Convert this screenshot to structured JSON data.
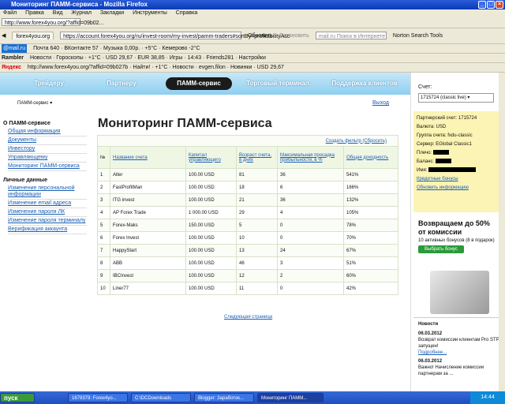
{
  "window": {
    "title": "Мониторинг ПАММ-сервиса - Mozilla Firefox"
  },
  "menu": [
    "Файл",
    "Правка",
    "Вид",
    "Журнал",
    "Закладки",
    "Инструменты",
    "Справка"
  ],
  "browser": {
    "bookmark_url": "http://www.forex4you.org/?affid=09b02...",
    "tab1": "forex4you.org",
    "tab2": "Мониторинг ПАММ-сервиса",
    "url": "https://account.forex4you.org/ru/invest-room/my-invest/pamm-traders#sortBy=profitabilityAsc",
    "reload": "Обновить",
    "stop": "Остановить",
    "search_ph": "mail.ru Поиск в Интернете",
    "norton": "Norton Search Tools",
    "toolbar2": "Почта 640 · ВКонтакте 57 · Музыка 0,00р. · +5°C · Кемерово -2°C",
    "toolbar3": "Новости · Гороскопы · +1°C · USD 29,67 · EUR 38,85 · Игры · 14:43 · Friends281 · Настройки",
    "toolbar4": "http://www.forex4you.org/?affid=09b027b · Найти! · +1°C · Новости · evgen.filon · Новинки · USD 29,67"
  },
  "site": {
    "nav": [
      "Трейдеру",
      "Партнеру",
      "ПАММ-сервис",
      "Торговый терминал",
      "Поддержка клиентов"
    ],
    "selector": "ПАММ-сервис ▾",
    "exit": "Выход",
    "left_h1": "О ПАММ-сервисе",
    "left_links1": [
      "Общая информация",
      "Документы",
      "Инвестору",
      "Управляющему",
      "Мониторинг ПАММ-сервиса"
    ],
    "left_h2": "Личные данные",
    "left_links2": [
      "Изменение персональной информации",
      "Изменение email адреса",
      "Изменение пароля ЛК",
      "Изменение пароля терминалу",
      "Верификация аккаунта"
    ],
    "page_title": "Мониторинг ПАММ-сервиса",
    "filter_link": "Создать фильтр (Сбросить)",
    "columns": [
      "№",
      "Название счета",
      "Капитал управляющего",
      "Возраст счета, в днях",
      "Максимальная просадка прибыльности, в %",
      "Общая доходность"
    ],
    "rows": [
      [
        "1",
        "Alter",
        "100.00 USD",
        "81",
        "36",
        "541%"
      ],
      [
        "2",
        "FastProfitMan",
        "100.00 USD",
        "18",
        "6",
        "166%"
      ],
      [
        "3",
        "ITG invest",
        "100.00 USD",
        "21",
        "36",
        "132%"
      ],
      [
        "4",
        "AP Forex Trade",
        "1 000.00 USD",
        "29",
        "4",
        "105%"
      ],
      [
        "5",
        "Forex-Maks",
        "150.00 USD",
        "5",
        "0",
        "78%"
      ],
      [
        "6",
        "Forex Invest",
        "100.00 USD",
        "10",
        "0",
        "70%"
      ],
      [
        "7",
        "HappyStart",
        "100.00 USD",
        "13",
        "24",
        "67%"
      ],
      [
        "8",
        "ABB",
        "100.00 USD",
        "46",
        "3",
        "51%"
      ],
      [
        "9",
        "IBCInvest",
        "100.00 USD",
        "12",
        "2",
        "60%"
      ],
      [
        "10",
        "Liner77",
        "100.00 USD",
        "11",
        "0",
        "42%"
      ]
    ],
    "next_page": "Следующая страница"
  },
  "sidebar": {
    "account_label": "Счет:",
    "account_value": "1715724 (classic live) ▾",
    "partner": "Партнерский счет: 1715724",
    "currency": "Валюта: USD",
    "group": "Группа счета: fxdu-classic",
    "server": "Сервер: EGlobal Classic1",
    "shoulder": "Плечо:",
    "balance": "Баланс:",
    "name": "Имя:",
    "credit_bonus": "Кредитные бонусы",
    "update_info": "Обновить информацию",
    "promo_big": "Возвращаем до 50% от комиссии",
    "promo_small": "10 активных бонусов (8 в подарок)",
    "promo_btn": "Выбрать бонус",
    "news_title": "Новости",
    "news1_date": "06.03.2012",
    "news1": "Возврат комиссии клиентам Pro STP запущен!",
    "news1_more": "Подробнее...",
    "news2_date": "06.03.2012",
    "news2": "Важно! Начисление комиссии партнерам за ..."
  },
  "taskbar": {
    "start": "пуск",
    "tasks": [
      "1679379: Forex4yo...",
      "C:\\DCDownloads",
      "Blogger: Заработок...",
      "Мониторинг ПАММ..."
    ],
    "clock": "14:44"
  }
}
